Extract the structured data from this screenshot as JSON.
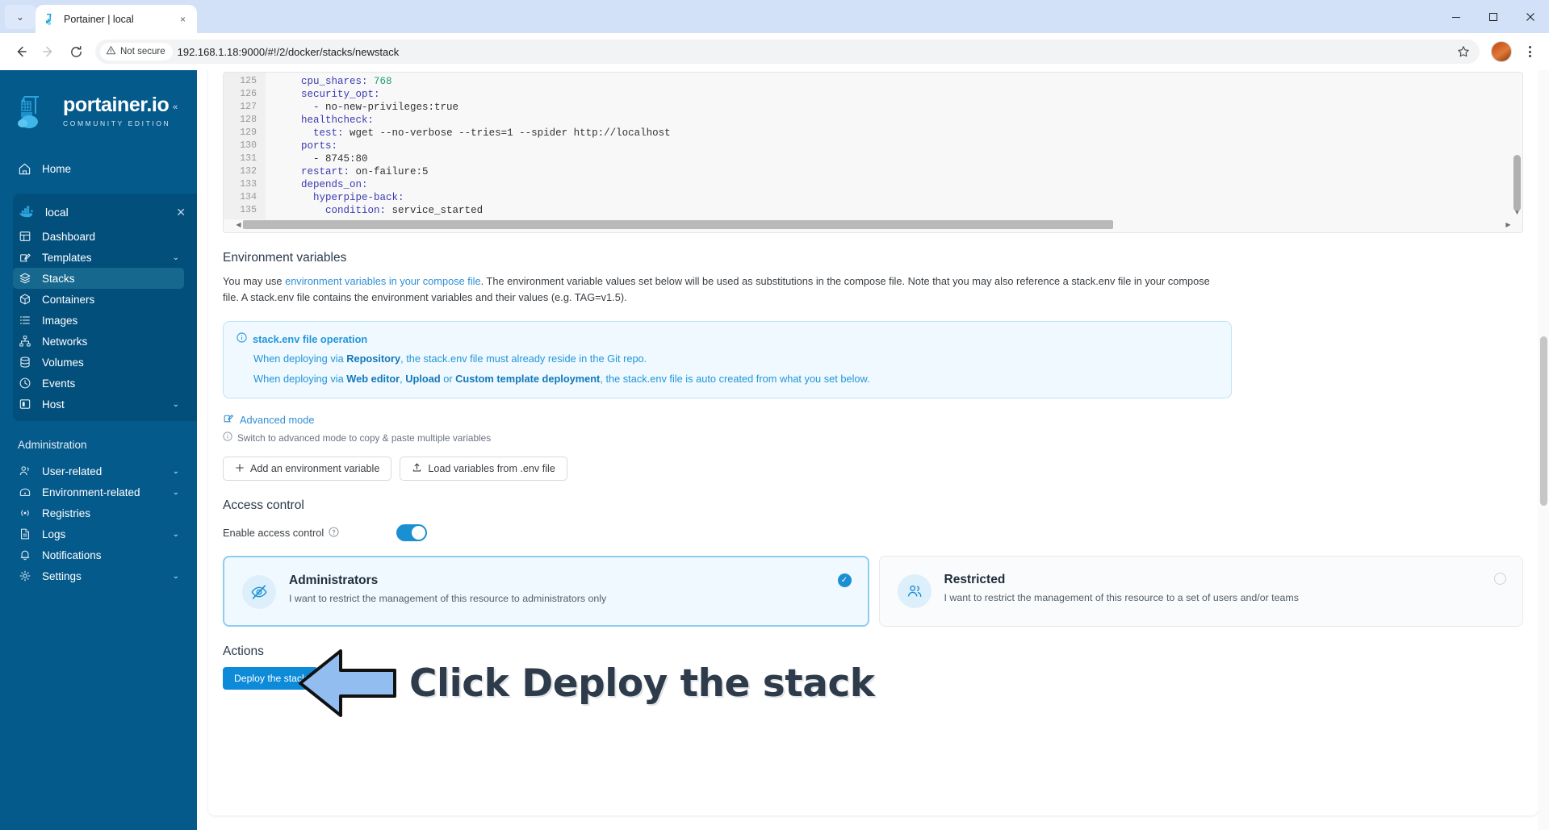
{
  "browser": {
    "tab": {
      "title": "Portainer | local",
      "favicon": "portainer-favicon",
      "close_label": "×"
    },
    "tab_chevron": "⌄",
    "window_controls": {
      "minimize": "–",
      "maximize": "❐",
      "close": "✕"
    },
    "nav": {
      "back": "←",
      "forward": "→",
      "reload": "⟳"
    },
    "security": {
      "label": "Not secure",
      "icon": "warning-triangle-icon"
    },
    "url": "192.168.1.18:9000/#!/2/docker/stacks/newstack",
    "star": "☆",
    "profile": "user-avatar",
    "menu": "three-dot-menu"
  },
  "sidebar": {
    "brand": {
      "name": "portainer.io",
      "subtitle": "COMMUNITY EDITION"
    },
    "collapse": "«",
    "home": {
      "label": "Home",
      "icon": "home-icon"
    },
    "environment": {
      "label": "local",
      "icon": "docker-icon",
      "close": "✕"
    },
    "env_items": [
      {
        "label": "Dashboard",
        "icon": "dashboard-icon",
        "chevron": "",
        "active": false
      },
      {
        "label": "Templates",
        "icon": "templates-icon",
        "chevron": "⌄",
        "active": false
      },
      {
        "label": "Stacks",
        "icon": "stacks-icon",
        "chevron": "",
        "active": true
      },
      {
        "label": "Containers",
        "icon": "containers-icon",
        "chevron": "",
        "active": false
      },
      {
        "label": "Images",
        "icon": "images-icon",
        "chevron": "",
        "active": false
      },
      {
        "label": "Networks",
        "icon": "networks-icon",
        "chevron": "",
        "active": false
      },
      {
        "label": "Volumes",
        "icon": "volumes-icon",
        "chevron": "",
        "active": false
      },
      {
        "label": "Events",
        "icon": "events-icon",
        "chevron": "",
        "active": false
      },
      {
        "label": "Host",
        "icon": "host-icon",
        "chevron": "⌄",
        "active": false
      }
    ],
    "admin_title": "Administration",
    "admin_items": [
      {
        "label": "User-related",
        "icon": "users-icon",
        "chevron": "⌄"
      },
      {
        "label": "Environment-related",
        "icon": "environment-icon",
        "chevron": "⌄"
      },
      {
        "label": "Registries",
        "icon": "registries-icon",
        "chevron": ""
      },
      {
        "label": "Logs",
        "icon": "logs-icon",
        "chevron": "⌄"
      },
      {
        "label": "Notifications",
        "icon": "bell-icon",
        "chevron": ""
      },
      {
        "label": "Settings",
        "icon": "gear-icon",
        "chevron": "⌄"
      }
    ]
  },
  "editor": {
    "lines": [
      {
        "num": "125",
        "indent": 4,
        "key": "cpu_shares",
        "sep": ": ",
        "val": "768",
        "val_type": "n"
      },
      {
        "num": "126",
        "indent": 4,
        "key": "security_opt",
        "sep": ":",
        "val": "",
        "val_type": "s"
      },
      {
        "num": "127",
        "indent": 6,
        "key": "",
        "sep": "",
        "val": "- no-new-privileges:true",
        "val_type": "s"
      },
      {
        "num": "128",
        "indent": 4,
        "key": "healthcheck",
        "sep": ":",
        "val": "",
        "val_type": "s"
      },
      {
        "num": "129",
        "indent": 6,
        "key": "test",
        "sep": ": ",
        "val": "wget --no-verbose --tries=1 --spider http://localhost",
        "val_type": "s"
      },
      {
        "num": "130",
        "indent": 4,
        "key": "ports",
        "sep": ":",
        "val": "",
        "val_type": "s"
      },
      {
        "num": "131",
        "indent": 6,
        "key": "",
        "sep": "",
        "val": "- 8745:80",
        "val_type": "s"
      },
      {
        "num": "132",
        "indent": 4,
        "key": "restart",
        "sep": ": ",
        "val": "on-failure:5",
        "val_type": "s"
      },
      {
        "num": "133",
        "indent": 4,
        "key": "depends_on",
        "sep": ":",
        "val": "",
        "val_type": "s"
      },
      {
        "num": "134",
        "indent": 6,
        "key": "hyperpipe-back",
        "sep": ":",
        "val": "",
        "val_type": "s"
      },
      {
        "num": "135",
        "indent": 8,
        "key": "condition",
        "sep": ": ",
        "val": "service_started",
        "val_type": "s"
      }
    ]
  },
  "env_section": {
    "title": "Environment variables",
    "desc_1": "You may use ",
    "desc_link": "environment variables in your compose file",
    "desc_2": ". The environment variable values set below will be used as substitutions in the compose file. Note that you may also reference a stack.env file in your compose file. A stack.env file contains the environment variables and their values (e.g. TAG=v1.5).",
    "info": {
      "icon": "info-circle-icon",
      "title": "stack.env file operation",
      "line1_pre": "When deploying via ",
      "line1_bold": "Repository",
      "line1_post": ", the stack.env file must already reside in the Git repo.",
      "line2_pre": "When deploying via ",
      "line2_bold1": "Web editor",
      "line2_mid1": ", ",
      "line2_bold2": "Upload",
      "line2_mid2": " or ",
      "line2_bold3": "Custom template deployment",
      "line2_post": ", the stack.env file is auto created from what you set below."
    },
    "advanced_link": "Advanced mode",
    "advanced_icon": "edit-square-icon",
    "advanced_hint": "Switch to advanced mode to copy & paste multiple variables",
    "advanced_hint_icon": "info-circle-icon",
    "buttons": [
      {
        "label": "Add an environment variable",
        "icon": "plus-icon"
      },
      {
        "label": "Load variables from .env file",
        "icon": "upload-icon"
      }
    ]
  },
  "access_control": {
    "title": "Access control",
    "toggle_label": "Enable access control",
    "toggle_help_icon": "question-circle-icon",
    "toggle_on": true,
    "options": [
      {
        "title": "Administrators",
        "desc": "I want to restrict the management of this resource to administrators only",
        "icon": "eye-off-icon",
        "selected": true,
        "check": "✓"
      },
      {
        "title": "Restricted",
        "desc": "I want to restrict the management of this resource to a set of users and/or teams",
        "icon": "users-group-icon",
        "selected": false,
        "check": ""
      }
    ]
  },
  "actions": {
    "title": "Actions",
    "deploy_label": "Deploy the stack"
  },
  "annotation": {
    "text": "Click Deploy the stack",
    "arrow_icon": "left-arrow-annotation",
    "arrow_fill": "#92bdf0",
    "arrow_stroke": "#111111",
    "text_color": "#2e3b4a"
  },
  "colors": {
    "sidebar_bg": "#055a8c",
    "sidebar_env_bg": "#034f7c",
    "sidebar_active": "#17688f",
    "accent": "#0d8bd9",
    "info_bg": "#f0f9ff",
    "info_border": "#bfe3f7",
    "info_text": "#2196d9",
    "tabstrip": "#d2e1f8"
  }
}
